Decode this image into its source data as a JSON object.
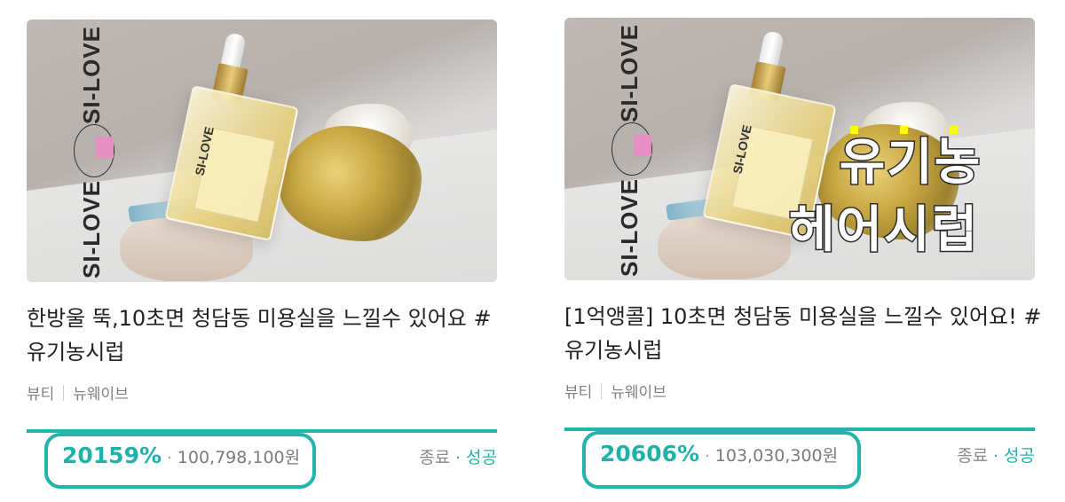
{
  "cards": [
    {
      "title": "한방울 뚝,10초면 청담동 미용실을 느낄수 있어요 #유기농시럽",
      "category": "뷰티",
      "maker": "뉴웨이브",
      "percent": "20159%",
      "amount": "100,798,100원",
      "status_ended": "종료",
      "status_result": "성공",
      "progress": 1.0,
      "image": {
        "brand": "SI-LOVE",
        "overlay_lines": []
      }
    },
    {
      "title": "[1억앵콜] 10초면 청담동 미용실을 느낄수 있어요! #유기농시럽",
      "category": "뷰티",
      "maker": "뉴웨이브",
      "percent": "20606%",
      "amount": "103,030,300원",
      "status_ended": "종료",
      "status_result": "성공",
      "progress": 1.0,
      "image": {
        "brand": "SI-LOVE",
        "overlay_lines": [
          "유기농",
          "헤어시럽"
        ]
      }
    }
  ],
  "separator": "·",
  "colors": {
    "accent": "#20b2aa",
    "highlight": "#22b3ad",
    "muted": "#808080"
  }
}
